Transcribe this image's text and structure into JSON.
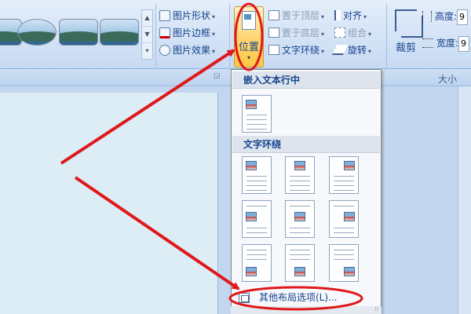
{
  "ribbon": {
    "picture_format": {
      "shape": "图片形状",
      "border": "图片边框",
      "effects": "图片效果"
    },
    "position": {
      "label": "位置"
    },
    "arrange": {
      "bring_front": "置于顶层",
      "send_back": "置于底层",
      "text_wrap": "文字环绕",
      "align": "对齐",
      "group": "组合",
      "rotate": "旋转"
    },
    "crop": {
      "label": "裁剪"
    },
    "size": {
      "height_label": "高度:",
      "height_value": "9",
      "width_label": "宽度:",
      "width_value": "9",
      "group_label": "大小"
    }
  },
  "dropdown": {
    "section_inline": "嵌入文本行中",
    "section_wrap": "文字环绕",
    "more_options": "其他布局选项(L)..."
  },
  "colors": {
    "annotation": "#e0181c",
    "highlight": "#ffd56e",
    "ribbon_text": "#15428b"
  }
}
